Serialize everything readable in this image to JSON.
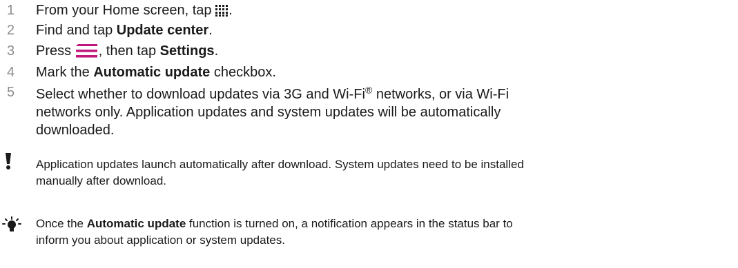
{
  "steps": [
    {
      "number": "1",
      "before": "From your Home screen, tap ",
      "icon": "apps-grid-icon",
      "after": "."
    },
    {
      "number": "2",
      "before": "Find and tap ",
      "bold": "Update center",
      "after": "."
    },
    {
      "number": "3",
      "before": "Press ",
      "icon": "menu-lines-icon",
      "middle": ", then tap ",
      "bold": "Settings",
      "after": "."
    },
    {
      "number": "4",
      "before": "Mark the ",
      "bold": "Automatic update",
      "after": " checkbox."
    },
    {
      "number": "5",
      "line1": "Select whether to download updates via 3G and Wi-Fi",
      "sup": "®",
      "line1b": " networks, or via Wi-Fi",
      "line2": "networks only. Application updates and system updates will be automatically",
      "line3": "downloaded."
    }
  ],
  "warning": {
    "icon": "exclamation-icon",
    "line1": "Application updates launch automatically after download. System updates need to be installed",
    "line2": "manually after download."
  },
  "tip": {
    "icon": "lightbulb-icon",
    "before": "Once the ",
    "bold": "Automatic update",
    "after": " function is turned on, a notification appears in the status bar to",
    "line2": "inform you about application or system updates."
  },
  "colors": {
    "accent_menu": "#c0187a",
    "step_number": "#8c8c8c",
    "text": "#1a1a1a"
  }
}
